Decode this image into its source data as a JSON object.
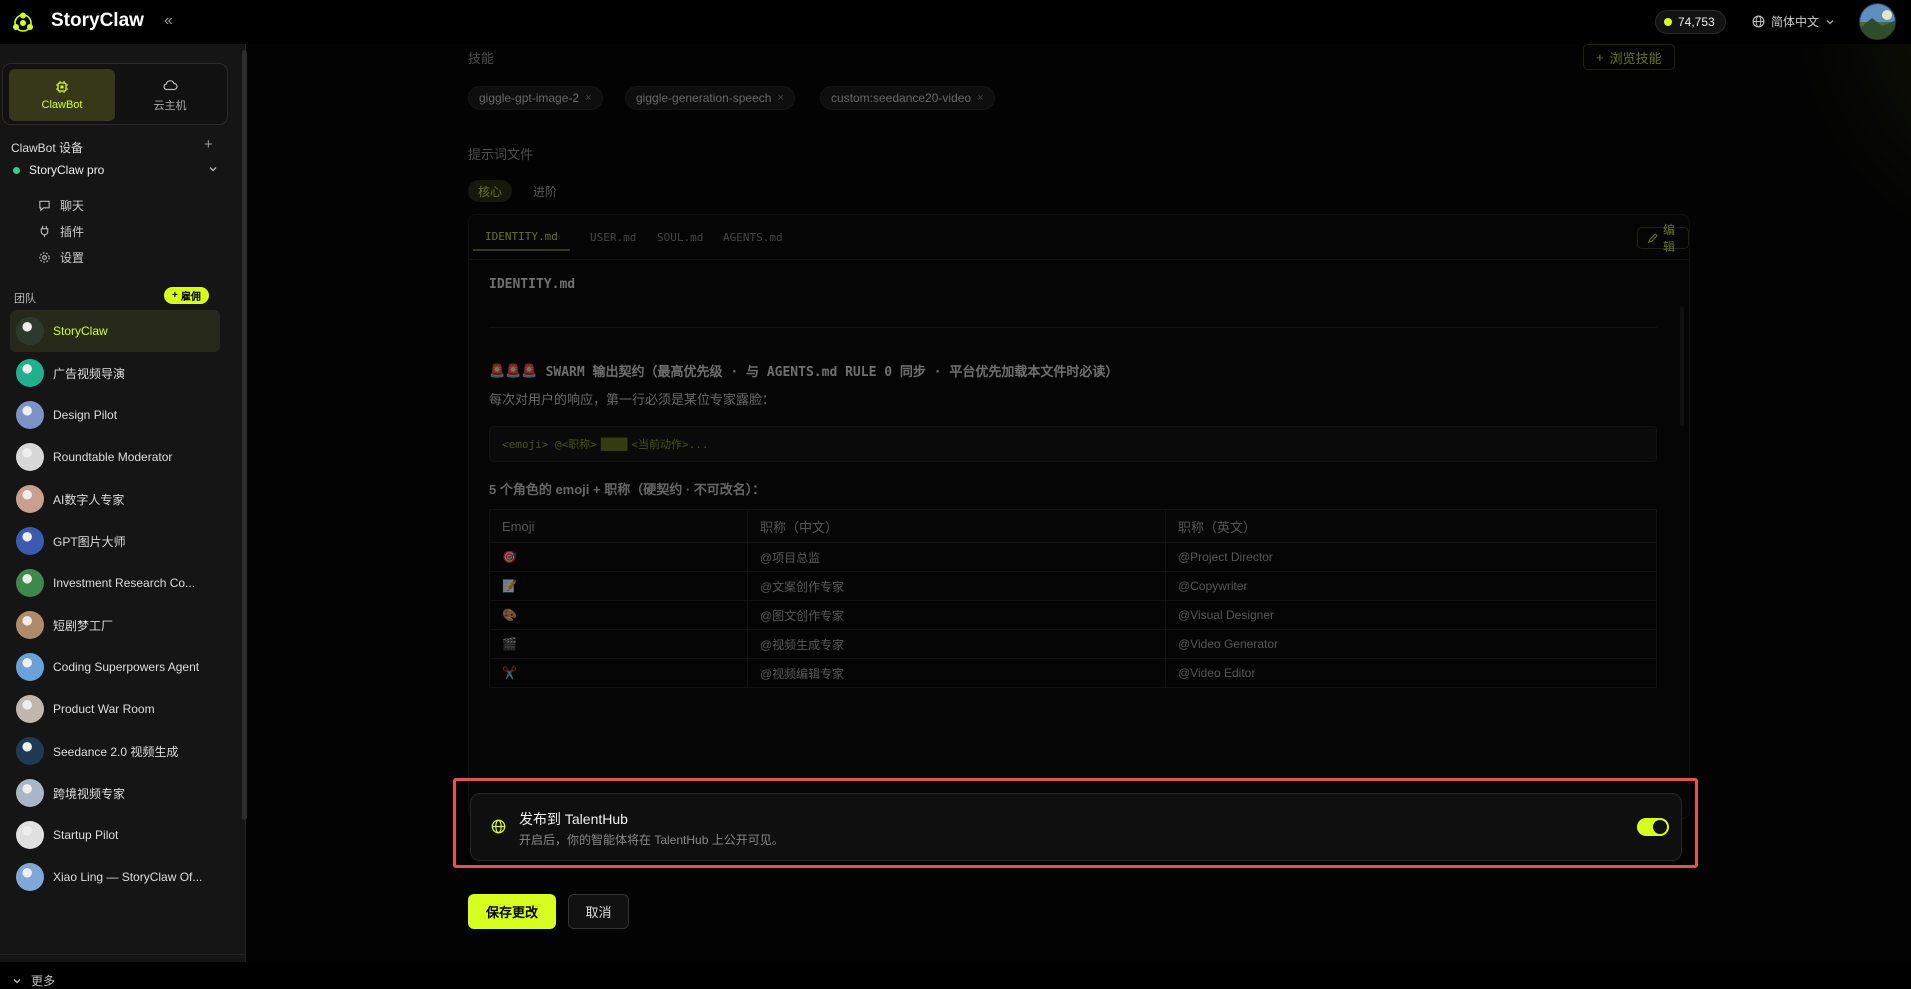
{
  "app": {
    "brand": "StoryClaw",
    "credits": "74,753",
    "language": "简体中文"
  },
  "sidebar": {
    "mode_tabs": [
      {
        "label": "ClawBot",
        "icon": "chip-icon"
      },
      {
        "label": "云主机",
        "icon": "cloud-icon"
      }
    ],
    "devices_title": "ClawBot 设备",
    "device": {
      "name": "StoryClaw pro",
      "status_color": "#3ec98a"
    },
    "device_nav": [
      {
        "label": "聊天",
        "icon": "chat-icon"
      },
      {
        "label": "插件",
        "icon": "plug-icon"
      },
      {
        "label": "设置",
        "icon": "gear-icon"
      }
    ],
    "team_title": "团队",
    "hire_label": "雇佣",
    "agents": [
      {
        "name": "StoryClaw",
        "color": "#2f3a2f"
      },
      {
        "name": "广告视频导演",
        "color": "#21b08c"
      },
      {
        "name": "Design Pilot",
        "color": "#7d92c7"
      },
      {
        "name": "Roundtable Moderator",
        "color": "#d7d7d7"
      },
      {
        "name": "AI数字人专家",
        "color": "#c99f8e"
      },
      {
        "name": "GPT图片大师",
        "color": "#3b5ab0"
      },
      {
        "name": "Investment Research Co...",
        "color": "#3d8a4a"
      },
      {
        "name": "短剧梦工厂",
        "color": "#b08b6a"
      },
      {
        "name": "Coding Superpowers Agent",
        "color": "#6aa1d8"
      },
      {
        "name": "Product War Room",
        "color": "#c0b8b0"
      },
      {
        "name": "Seedance 2.0 视频生成",
        "color": "#1f3a55"
      },
      {
        "name": "跨境视频专家",
        "color": "#aab6c5"
      },
      {
        "name": "Startup Pilot",
        "color": "#e0e0e0"
      },
      {
        "name": "Xiao Ling — StoryClaw Of...",
        "color": "#7fa8d8"
      }
    ],
    "more_label": "更多"
  },
  "main": {
    "skills_label": "技能",
    "browse_skills": "浏览技能",
    "skills": [
      "giggle-gpt-image-2",
      "giggle-generation-speech",
      "custom:seedance20-video"
    ],
    "prompt_files_label": "提示词文件",
    "prompt_tabs": [
      "核心",
      "进阶"
    ],
    "file_tabs": [
      "IDENTITY.md",
      "USER.md",
      "SOUL.md",
      "AGENTS.md"
    ],
    "edit_label": "编辑",
    "doc": {
      "heading": "IDENTITY.md",
      "swarm_emoji": "🚨🚨🚨",
      "swarm_title": "SWARM 输出契约（最高优先级 · 与 AGENTS.md RULE 0 同步 · 平台优先加载本文件时必读）",
      "para": "每次对用户的响应，第一行必须是某位专家露脸：",
      "code": [
        "<emoji> @<职称>",
        "████",
        "<当前动作>..."
      ],
      "subheading": "5 个角色的 emoji + 职称（硬契约 · 不可改名）：",
      "table_headers": [
        "Emoji",
        "职称（中文）",
        "职称（英文）"
      ],
      "table_rows": [
        [
          "🎯",
          "@项目总监",
          "@Project Director"
        ],
        [
          "📝",
          "@文案创作专家",
          "@Copywriter"
        ],
        [
          "🎨",
          "@图文创作专家",
          "@Visual Designer"
        ],
        [
          "🎬",
          "@视频生成专家",
          "@Video Generator"
        ],
        [
          "✂️",
          "@视频编辑专家",
          "@Video Editor"
        ]
      ]
    },
    "publish": {
      "title": "发布到 TalentHub",
      "subtitle": "开启后，你的智能体将在 TalentHub 上公开可见。",
      "enabled": true
    },
    "save_label": "保存更改",
    "cancel_label": "取消"
  },
  "colors": {
    "accent": "#d6ff1f",
    "highlight_border": "#e25454"
  }
}
